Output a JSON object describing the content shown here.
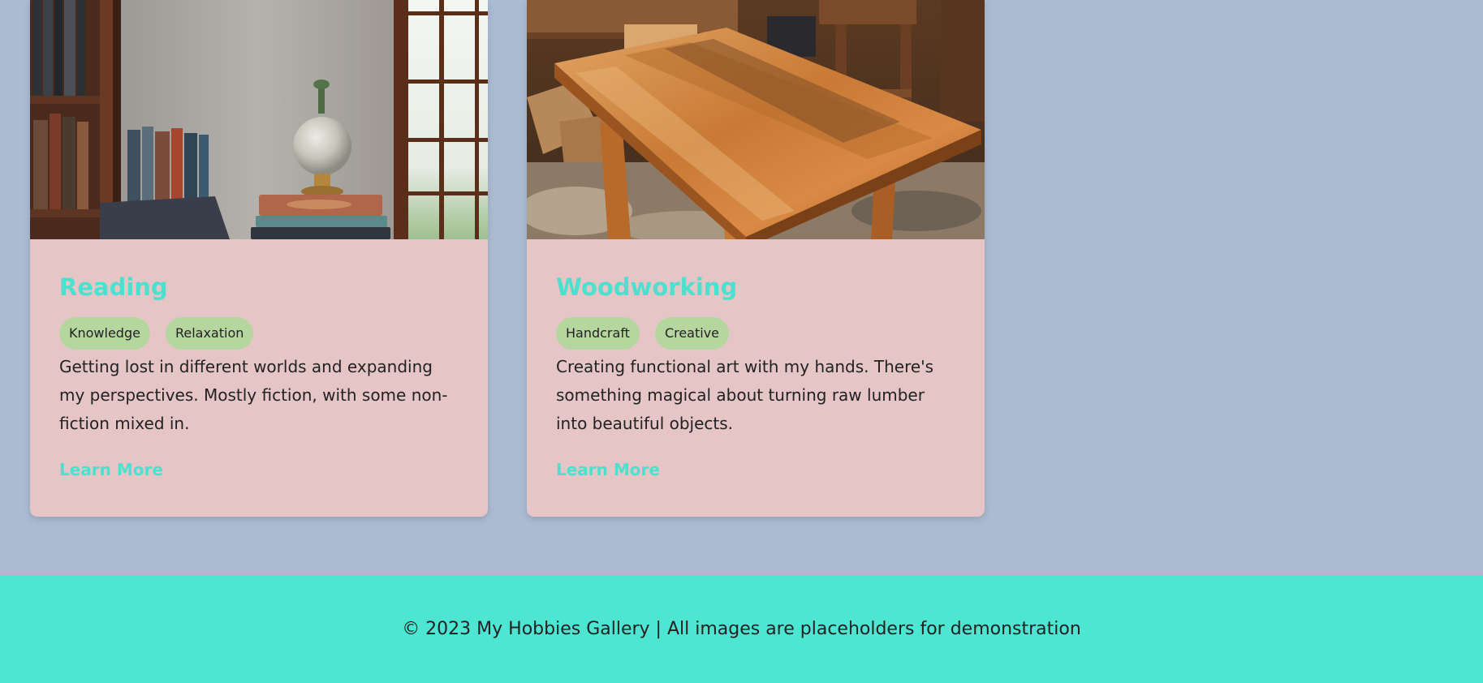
{
  "colors": {
    "page_background": "#abbcd2",
    "card_background": "#e6c5c7",
    "accent": "#4ee0cf",
    "tag_background": "#b6d6a0",
    "footer_background": "#4de6d3"
  },
  "cards": [
    {
      "title": "Reading",
      "image_icon": "reading-room-photo",
      "tags": [
        "Knowledge",
        "Relaxation"
      ],
      "description": "Getting lost in different worlds and expanding my perspectives. Mostly fiction, with some non-fiction mixed in.",
      "link_label": "Learn More"
    },
    {
      "title": "Woodworking",
      "image_icon": "woodworking-table-photo",
      "tags": [
        "Handcraft",
        "Creative"
      ],
      "description": "Creating functional art with my hands. There's something magical about turning raw lumber into beautiful objects.",
      "link_label": "Learn More"
    }
  ],
  "footer": {
    "text": "© 2023 My Hobbies Gallery | All images are placeholders for demonstration"
  }
}
